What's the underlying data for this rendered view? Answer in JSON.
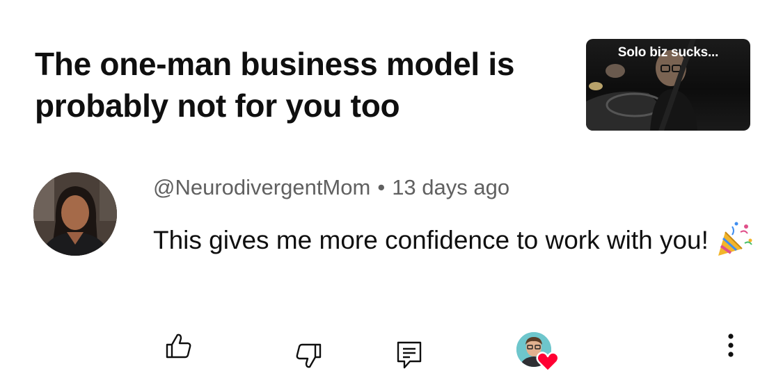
{
  "video": {
    "title": "The one-man business model is probably not for you too",
    "thumbnail_text": "Solo biz sucks..."
  },
  "comment": {
    "author": "@NeurodivergentMom",
    "separator": "•",
    "time": "13 days ago",
    "text": "This gives me more confidence to work with you!",
    "emoji": "party-popper"
  },
  "actions": {
    "like_icon": "thumb-up-icon",
    "dislike_icon": "thumb-down-icon",
    "reply_icon": "comment-icon",
    "creator_heart": "heart-icon",
    "more_icon": "more-vertical-icon"
  },
  "colors": {
    "text_primary": "#0f0f0f",
    "text_secondary": "#606060",
    "heart": "#ff0033"
  }
}
